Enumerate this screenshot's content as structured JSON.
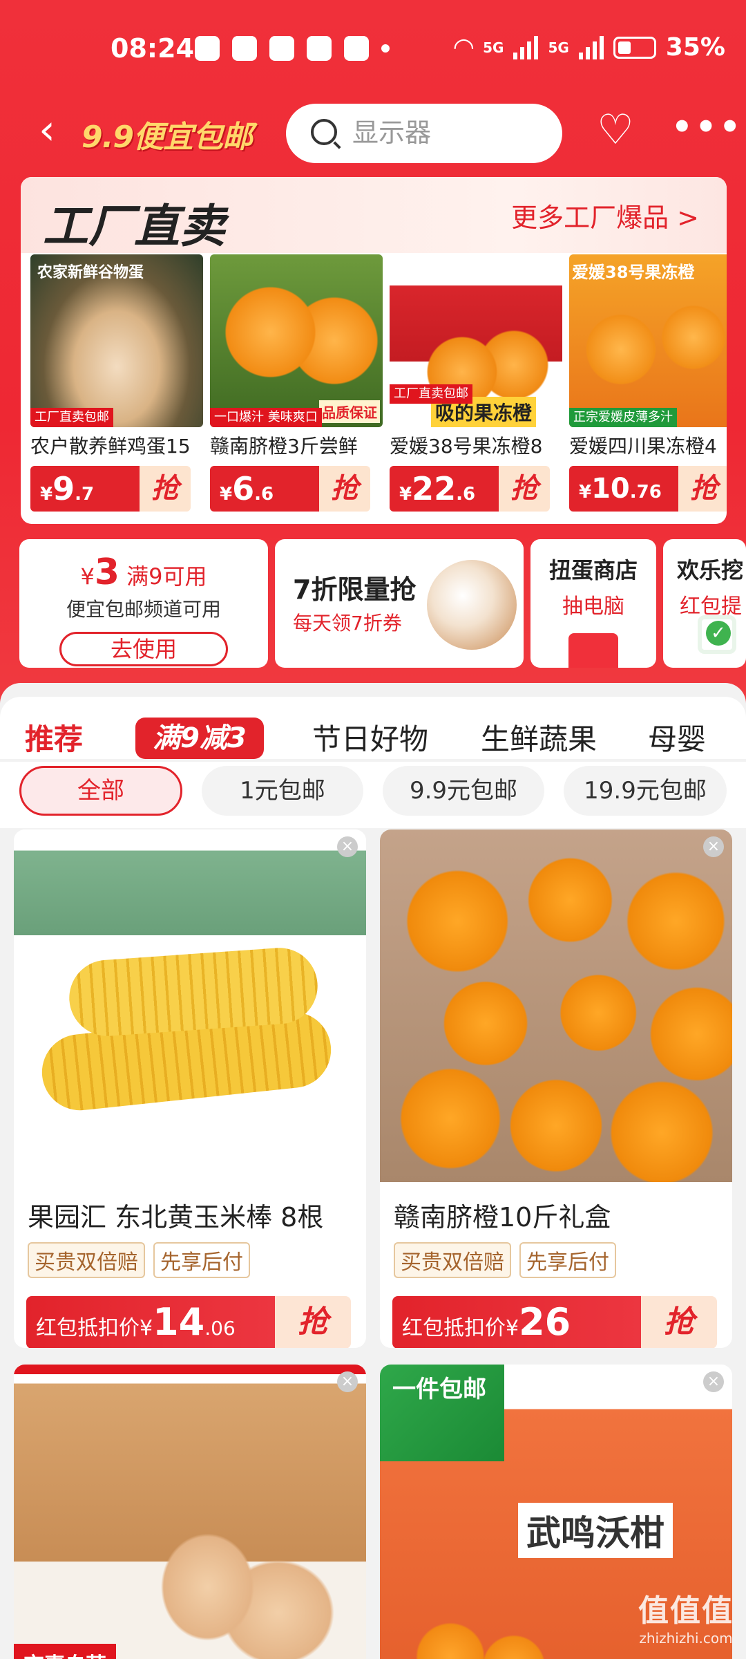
{
  "status": {
    "time": "08:24",
    "network_1": "5G",
    "network_2": "5G",
    "battery": "35%"
  },
  "header": {
    "brand": "9.9便宜包邮",
    "search_placeholder": "显示器"
  },
  "factory": {
    "title": "工厂直卖",
    "more": "更多工厂爆品 >",
    "products": [
      {
        "name": "农户散养鲜鸡蛋15",
        "price": "9",
        "price_dec": ".7",
        "grab": "抢",
        "tag": "工厂直卖包邮",
        "img_text": "农家新鲜谷物蛋"
      },
      {
        "name": "赣南脐橙3斤尝鲜",
        "price": "6",
        "price_dec": ".6",
        "grab": "抢",
        "tag": "一口爆汁 美味爽口",
        "img_text": "品质保证"
      },
      {
        "name": "爱媛38号果冻橙8",
        "price": "22",
        "price_dec": ".6",
        "grab": "抢",
        "tag": "工厂直卖包邮",
        "img_text": "吸的果冻橙"
      },
      {
        "name": "爱媛四川果冻橙4",
        "price": "10",
        "price_dec": ".76",
        "grab": "抢",
        "tag": "正宗爱媛皮薄多汁",
        "img_text": "爱媛38号果冻橙"
      }
    ]
  },
  "promos": {
    "coupon": {
      "amount": "3",
      "cond": "满9可用",
      "desc": "便宜包邮频道可用",
      "use": "去使用"
    },
    "flash": {
      "title": "7折限量抢",
      "sub": "每天领7折券"
    },
    "gacha": {
      "title": "扭蛋商店",
      "sub": "抽电脑"
    },
    "happy": {
      "title": "欢乐挖",
      "sub": "红包提"
    }
  },
  "tabs": {
    "items": [
      "推荐",
      "节日好物",
      "生鲜蔬果",
      "母婴"
    ],
    "badge": "满9减3"
  },
  "chips": [
    "全部",
    "1元包邮",
    "9.9元包邮",
    "19.9元包邮"
  ],
  "feed": [
    {
      "title": "果园汇 东北黄玉米棒 8根",
      "badges": [
        "买贵双倍赔",
        "先享后付"
      ],
      "price_label": "红包抵扣价¥",
      "price": "14",
      "price_dec": ".06",
      "grab": "抢"
    },
    {
      "title": "赣南脐橙10斤礼盒",
      "badges": [
        "买贵双倍赔",
        "先享后付"
      ],
      "price_label": "红包抵扣价¥",
      "price": "26",
      "price_dec": "",
      "grab": "抢"
    },
    {
      "title": "",
      "tag": "京喜自营"
    },
    {
      "title": "",
      "tag": "一件包邮",
      "box_text": "武鸣沃柑"
    }
  ],
  "watermark": {
    "line1": "值值值",
    "line2": "zhizhizhi.com"
  },
  "colors": {
    "brand_red": "#e2232b",
    "bg": "#f2f2f2"
  }
}
